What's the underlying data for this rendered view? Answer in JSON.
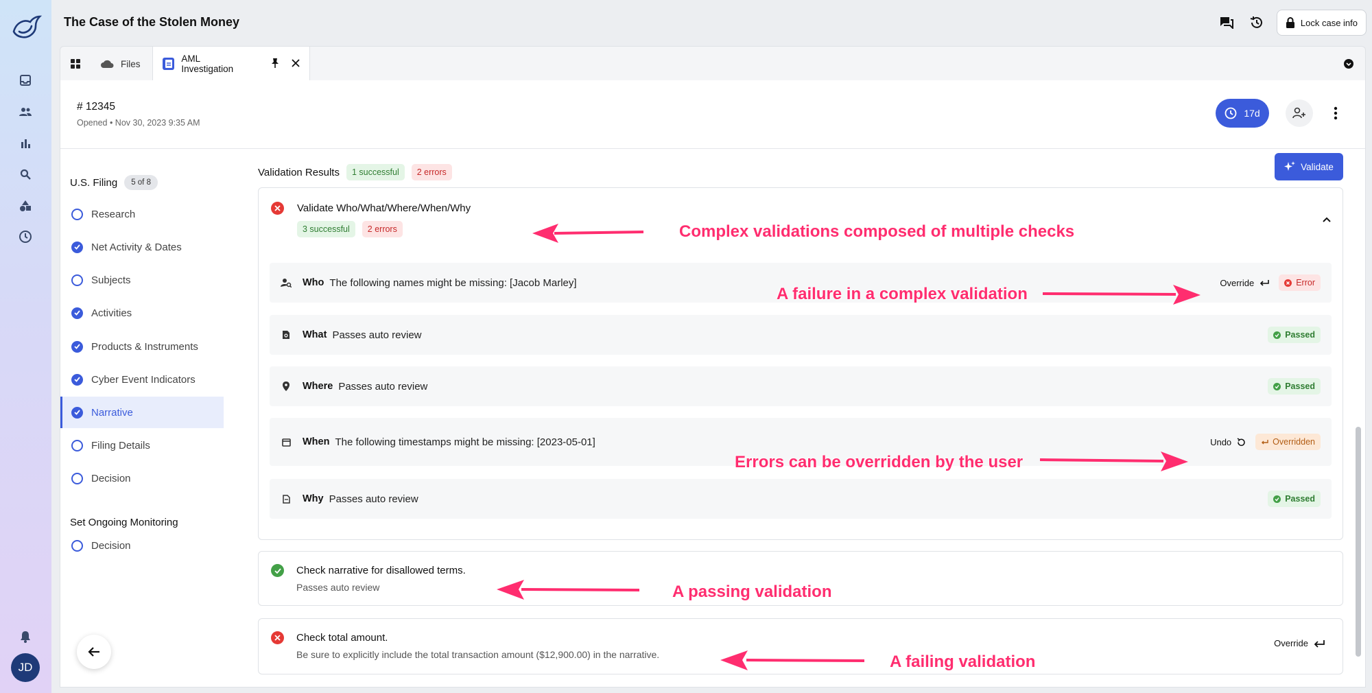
{
  "app": {
    "title": "The Case of the Stolen Money",
    "lock_label": "Lock case info",
    "user_initials": "JD"
  },
  "tabs": [
    {
      "label": ""
    },
    {
      "label": "Files"
    },
    {
      "label": "AML Investigation"
    }
  ],
  "case": {
    "id": "# 12345",
    "opened": "Opened • Nov 30, 2023 9:35 AM",
    "timer": "17d"
  },
  "nav": {
    "group1": {
      "title": "U.S. Filing",
      "progress": "5 of 8"
    },
    "items": [
      {
        "label": "Research",
        "done": false
      },
      {
        "label": "Net Activity & Dates",
        "done": true
      },
      {
        "label": "Subjects",
        "done": false
      },
      {
        "label": "Activities",
        "done": true
      },
      {
        "label": "Products & Instruments",
        "done": true
      },
      {
        "label": "Cyber Event Indicators",
        "done": true
      },
      {
        "label": "Narrative",
        "done": true,
        "active": true
      },
      {
        "label": "Filing Details",
        "done": false
      },
      {
        "label": "Decision",
        "done": false
      }
    ],
    "group2": {
      "title": "Set Ongoing Monitoring"
    },
    "items2": [
      {
        "label": "Decision",
        "done": false
      }
    ]
  },
  "validation": {
    "title": "Validation Results",
    "successful": "1 successful",
    "errors": "2 errors",
    "validate_label": "Validate",
    "complex": {
      "title": "Validate Who/What/Where/When/Why",
      "successful": "3 successful",
      "errors": "2 errors",
      "rows": [
        {
          "key": "Who",
          "msg": "The following names might be missing: [Jacob Marley]",
          "action": "Override",
          "status": "Error"
        },
        {
          "key": "What",
          "msg": "Passes auto review",
          "status": "Passed"
        },
        {
          "key": "Where",
          "msg": "Passes auto review",
          "status": "Passed"
        },
        {
          "key": "When",
          "msg": "The following timestamps might be missing: [2023-05-01]",
          "action": "Undo",
          "status": "Overridden"
        },
        {
          "key": "Why",
          "msg": "Passes auto review",
          "status": "Passed"
        }
      ]
    },
    "terms": {
      "title": "Check narrative for disallowed terms.",
      "sub": "Passes auto review"
    },
    "amount": {
      "title": "Check total amount.",
      "sub": "Be sure to explicitly include the total transaction amount ($12,900.00) in the narrative.",
      "action": "Override"
    }
  },
  "annotations": {
    "a1": "Complex validations composed of multiple checks",
    "a2": "A failure in a complex validation",
    "a3": "Errors can be overridden by the user",
    "a4": "A passing validation",
    "a5": "A failing validation"
  },
  "colors": {
    "accent": "#3b5bdb",
    "annotation": "#ff2d6f",
    "error": "#e53935",
    "pass": "#43a047"
  }
}
